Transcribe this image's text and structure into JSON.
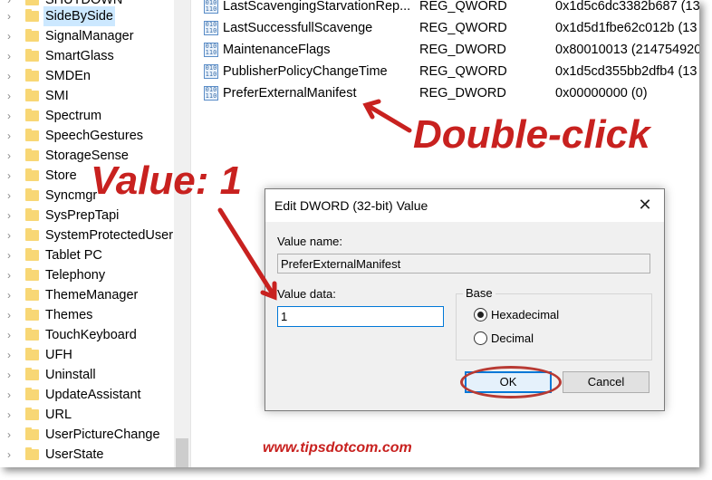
{
  "tree": {
    "items": [
      {
        "label": "SHUTDOWN"
      },
      {
        "label": "SideBySide",
        "selected": true
      },
      {
        "label": "SignalManager"
      },
      {
        "label": "SmartGlass"
      },
      {
        "label": "SMDEn"
      },
      {
        "label": "SMI"
      },
      {
        "label": "Spectrum"
      },
      {
        "label": "SpeechGestures"
      },
      {
        "label": "StorageSense"
      },
      {
        "label": "Store"
      },
      {
        "label": "Syncmgr"
      },
      {
        "label": "SysPrepTapi"
      },
      {
        "label": "SystemProtectedUser"
      },
      {
        "label": "Tablet PC"
      },
      {
        "label": "Telephony"
      },
      {
        "label": "ThemeManager"
      },
      {
        "label": "Themes"
      },
      {
        "label": "TouchKeyboard"
      },
      {
        "label": "UFH"
      },
      {
        "label": "Uninstall"
      },
      {
        "label": "UpdateAssistant"
      },
      {
        "label": "URL"
      },
      {
        "label": "UserPictureChange"
      },
      {
        "label": "UserState"
      }
    ]
  },
  "values": {
    "rows": [
      {
        "name": "LastScavengingStarvationRep...",
        "type": "REG_QWORD",
        "data": "0x1d5c6dc3382b687 (13"
      },
      {
        "name": "LastSuccessfullScavenge",
        "type": "REG_QWORD",
        "data": "0x1d5d1fbe62c012b (13"
      },
      {
        "name": "MaintenanceFlags",
        "type": "REG_DWORD",
        "data": "0x80010013 (214754920"
      },
      {
        "name": "PublisherPolicyChangeTime",
        "type": "REG_QWORD",
        "data": "0x1d5cd355bb2dfb4 (13"
      },
      {
        "name": "PreferExternalManifest",
        "type": "REG_DWORD",
        "data": "0x00000000 (0)"
      }
    ]
  },
  "annotations": {
    "double_click": "Double-click",
    "value_hint": "Value: 1",
    "website": "www.tipsdotcom.com",
    "color": "#c8211f"
  },
  "dialog": {
    "title": "Edit DWORD (32-bit) Value",
    "close_glyph": "✕",
    "value_name_label": "Value name:",
    "value_name": "PreferExternalManifest",
    "value_data_label": "Value data:",
    "value_data": "1",
    "base_label": "Base",
    "base_options": [
      {
        "label": "Hexadecimal",
        "selected": true
      },
      {
        "label": "Decimal",
        "selected": false
      }
    ],
    "ok_label": "OK",
    "cancel_label": "Cancel"
  }
}
